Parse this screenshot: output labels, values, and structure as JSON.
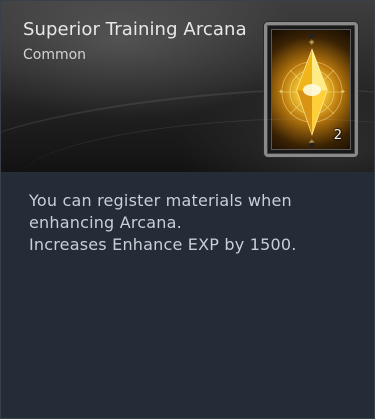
{
  "item": {
    "name": "Superior Training Arcana",
    "grade": "Common",
    "stack_count": "2",
    "card_icon": "golden-crystal-arcana-card-icon"
  },
  "description": {
    "line1": "You can register materials when",
    "line2": "enhancing Arcana.",
    "line3": "Increases Enhance EXP by 1500."
  },
  "colors": {
    "title_text": "#e8e8e8",
    "body_text": "#c9cfd6",
    "body_background": "#232c37",
    "frame_border": "#8a8a8a",
    "crystal_glow": "#f4c534"
  }
}
